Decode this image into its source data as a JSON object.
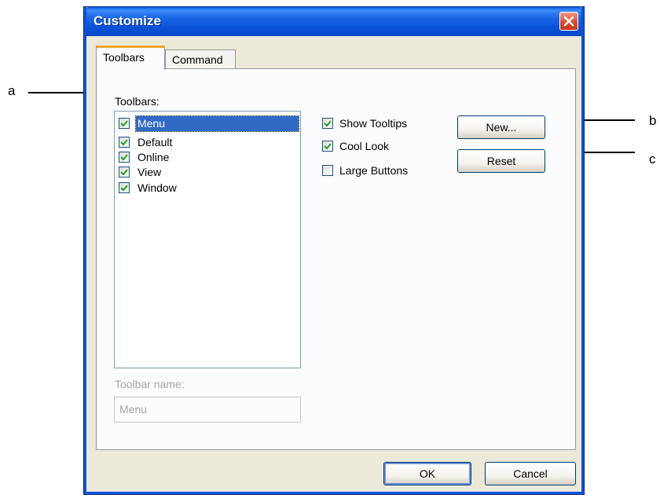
{
  "annotations": {
    "a": "a",
    "b": "b",
    "c": "c"
  },
  "window": {
    "title": "Customize",
    "close_icon": "close-icon"
  },
  "tabs": [
    {
      "label": "Toolbars",
      "active": true
    },
    {
      "label": "Command",
      "active": false
    }
  ],
  "toolbars": {
    "label": "Toolbars:",
    "items": [
      {
        "label": "Menu",
        "checked": true,
        "selected": true
      },
      {
        "label": "Default",
        "checked": true,
        "selected": false
      },
      {
        "label": "Online",
        "checked": true,
        "selected": false
      },
      {
        "label": "View",
        "checked": true,
        "selected": false
      },
      {
        "label": "Window",
        "checked": true,
        "selected": false
      }
    ]
  },
  "options": [
    {
      "label": "Show Tooltips",
      "checked": true
    },
    {
      "label": "Cool Look",
      "checked": true
    },
    {
      "label": "Large Buttons",
      "checked": false
    }
  ],
  "buttons": {
    "new_label": "New...",
    "reset_label": "Reset",
    "ok_label": "OK",
    "cancel_label": "Cancel"
  },
  "toolbar_name": {
    "label": "Toolbar name:",
    "value": "Menu"
  },
  "colors": {
    "selection": "#316ac5",
    "checkmark": "#21a121",
    "titlebar": "#0a52d8",
    "close_button": "#d9492a"
  }
}
